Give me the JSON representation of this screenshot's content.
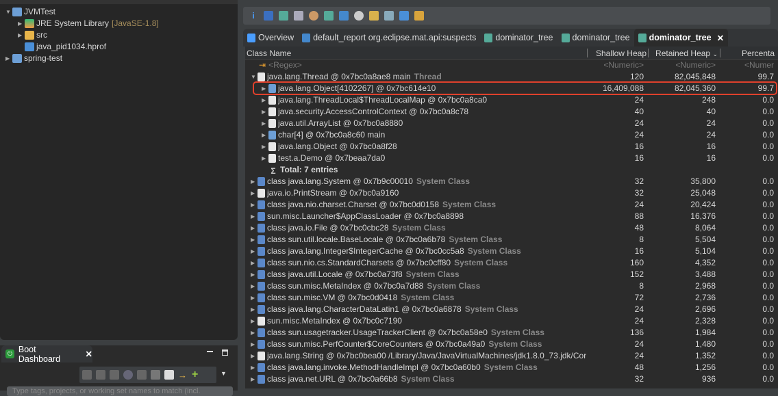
{
  "explorer": {
    "items": [
      {
        "label": "JVMTest",
        "expanded": true,
        "icon": "project-folder-icon"
      },
      {
        "label": "JRE System Library",
        "decoration": "[JavaSE-1.8]",
        "icon": "library-icon"
      },
      {
        "label": "src",
        "icon": "package-folder-icon"
      },
      {
        "label": "java_pid1034.hprof",
        "icon": "heap-dump-icon"
      },
      {
        "label": "spring-test",
        "icon": "spring-project-icon"
      }
    ]
  },
  "boot_dashboard": {
    "title": "Boot Dashboard",
    "search_placeholder": "Type tags, projects, or working set names to match (incl."
  },
  "editor_tabs": [
    {
      "label": "Overview",
      "icon": "info-icon"
    },
    {
      "label": "default_report  org.eclipse.mat.api:suspects",
      "icon": "report-icon"
    },
    {
      "label": "dominator_tree",
      "icon": "dominator-tree-icon"
    },
    {
      "label": "dominator_tree",
      "icon": "dominator-tree-icon"
    },
    {
      "label": "dominator_tree",
      "icon": "dominator-tree-icon",
      "active": true
    }
  ],
  "table": {
    "columns": [
      "Class Name",
      "Shallow Heap",
      "Retained Heap",
      "Percenta"
    ],
    "sort_column": "Retained Heap",
    "filter_row": {
      "name": "<Regex>",
      "shallow": "<Numeric>",
      "retained": "<Numeric>",
      "pct": "<Numer"
    },
    "rows": [
      {
        "level": 0,
        "exp": "open",
        "icon": "object",
        "name": "java.lang.Thread @ 0x7bc0a8ae8  main",
        "suffix": "Thread",
        "shallow": "120",
        "retained": "82,045,848",
        "pct": "99.7"
      },
      {
        "level": 1,
        "exp": "closed",
        "icon": "array",
        "name": "java.lang.Object[4102267] @ 0x7bc614e10",
        "suffix": "",
        "shallow": "16,409,088",
        "retained": "82,045,360",
        "pct": "99.7",
        "highlighted": true
      },
      {
        "level": 1,
        "exp": "closed",
        "icon": "object",
        "name": "java.lang.ThreadLocal$ThreadLocalMap @ 0x7bc0a8ca0",
        "suffix": "",
        "shallow": "24",
        "retained": "248",
        "pct": "0.0"
      },
      {
        "level": 1,
        "exp": "closed",
        "icon": "object",
        "name": "java.security.AccessControlContext @ 0x7bc0a8c78",
        "suffix": "",
        "shallow": "40",
        "retained": "40",
        "pct": "0.0"
      },
      {
        "level": 1,
        "exp": "closed",
        "icon": "object",
        "name": "java.util.ArrayList @ 0x7bc0a8880",
        "suffix": "",
        "shallow": "24",
        "retained": "24",
        "pct": "0.0"
      },
      {
        "level": 1,
        "exp": "closed",
        "icon": "array",
        "name": "char[4] @ 0x7bc0a8c60  main",
        "suffix": "",
        "shallow": "24",
        "retained": "24",
        "pct": "0.0"
      },
      {
        "level": 1,
        "exp": "closed",
        "icon": "object",
        "name": "java.lang.Object @ 0x7bc0a8f28",
        "suffix": "",
        "shallow": "16",
        "retained": "16",
        "pct": "0.0"
      },
      {
        "level": 1,
        "exp": "closed",
        "icon": "object",
        "name": "test.a.Demo @ 0x7beaa7da0",
        "suffix": "",
        "shallow": "16",
        "retained": "16",
        "pct": "0.0"
      },
      {
        "level": 1,
        "exp": "none",
        "icon": "sum",
        "name": "Total: 7 entries",
        "suffix": "",
        "shallow": "",
        "retained": "",
        "pct": "",
        "bold": true
      },
      {
        "level": 0,
        "exp": "closed",
        "icon": "class",
        "name": "class java.lang.System @ 0x7b9c00010",
        "suffix": "System Class",
        "shallow": "32",
        "retained": "35,800",
        "pct": "0.0"
      },
      {
        "level": 0,
        "exp": "closed",
        "icon": "object",
        "name": "java.io.PrintStream @ 0x7bc0a9160",
        "suffix": "",
        "shallow": "32",
        "retained": "25,048",
        "pct": "0.0"
      },
      {
        "level": 0,
        "exp": "closed",
        "icon": "class",
        "name": "class java.nio.charset.Charset @ 0x7bc0d0158",
        "suffix": "System Class",
        "shallow": "24",
        "retained": "20,424",
        "pct": "0.0"
      },
      {
        "level": 0,
        "exp": "closed",
        "icon": "loader",
        "name": "sun.misc.Launcher$AppClassLoader @ 0x7bc0a8898",
        "suffix": "",
        "shallow": "88",
        "retained": "16,376",
        "pct": "0.0"
      },
      {
        "level": 0,
        "exp": "closed",
        "icon": "class",
        "name": "class java.io.File @ 0x7bc0cbc28",
        "suffix": "System Class",
        "shallow": "48",
        "retained": "8,064",
        "pct": "0.0"
      },
      {
        "level": 0,
        "exp": "closed",
        "icon": "class",
        "name": "class sun.util.locale.BaseLocale @ 0x7bc0a6b78",
        "suffix": "System Class",
        "shallow": "8",
        "retained": "5,504",
        "pct": "0.0"
      },
      {
        "level": 0,
        "exp": "closed",
        "icon": "class",
        "name": "class java.lang.Integer$IntegerCache @ 0x7bc0cc5a8",
        "suffix": "System Class",
        "shallow": "16",
        "retained": "5,104",
        "pct": "0.0"
      },
      {
        "level": 0,
        "exp": "closed",
        "icon": "class",
        "name": "class sun.nio.cs.StandardCharsets @ 0x7bc0cff80",
        "suffix": "System Class",
        "shallow": "160",
        "retained": "4,352",
        "pct": "0.0"
      },
      {
        "level": 0,
        "exp": "closed",
        "icon": "class",
        "name": "class java.util.Locale @ 0x7bc0a73f8",
        "suffix": "System Class",
        "shallow": "152",
        "retained": "3,488",
        "pct": "0.0"
      },
      {
        "level": 0,
        "exp": "closed",
        "icon": "class",
        "name": "class sun.misc.MetaIndex @ 0x7bc0a7d88",
        "suffix": "System Class",
        "shallow": "8",
        "retained": "2,968",
        "pct": "0.0"
      },
      {
        "level": 0,
        "exp": "closed",
        "icon": "class",
        "name": "class sun.misc.VM @ 0x7bc0d0418",
        "suffix": "System Class",
        "shallow": "72",
        "retained": "2,736",
        "pct": "0.0"
      },
      {
        "level": 0,
        "exp": "closed",
        "icon": "class",
        "name": "class java.lang.CharacterDataLatin1 @ 0x7bc0a6878",
        "suffix": "System Class",
        "shallow": "24",
        "retained": "2,696",
        "pct": "0.0"
      },
      {
        "level": 0,
        "exp": "closed",
        "icon": "object",
        "name": "sun.misc.MetaIndex @ 0x7bc0c7190",
        "suffix": "",
        "shallow": "24",
        "retained": "2,328",
        "pct": "0.0"
      },
      {
        "level": 0,
        "exp": "closed",
        "icon": "class",
        "name": "class sun.usagetracker.UsageTrackerClient @ 0x7bc0a58e0",
        "suffix": "System Class",
        "shallow": "136",
        "retained": "1,984",
        "pct": "0.0"
      },
      {
        "level": 0,
        "exp": "closed",
        "icon": "class",
        "name": "class sun.misc.PerfCounter$CoreCounters @ 0x7bc0a49a0",
        "suffix": "System Class",
        "shallow": "24",
        "retained": "1,480",
        "pct": "0.0"
      },
      {
        "level": 0,
        "exp": "closed",
        "icon": "object",
        "name": "java.lang.String @ 0x7bc0bea00  /Library/Java/JavaVirtualMachines/jdk1.8.0_73.jdk/Cor",
        "suffix": "",
        "shallow": "24",
        "retained": "1,352",
        "pct": "0.0"
      },
      {
        "level": 0,
        "exp": "closed",
        "icon": "class",
        "name": "class java.lang.invoke.MethodHandleImpl @ 0x7bc0a60b0",
        "suffix": "System Class",
        "shallow": "48",
        "retained": "1,256",
        "pct": "0.0"
      },
      {
        "level": 0,
        "exp": "closed",
        "icon": "class",
        "name": "class java.net.URL @ 0x7bc0a66b8",
        "suffix": "System Class",
        "shallow": "32",
        "retained": "936",
        "pct": "0.0"
      }
    ]
  },
  "colors": {
    "highlight": "#e0412c",
    "background": "#2b2b2b",
    "suffix": "#8a8a8a"
  }
}
